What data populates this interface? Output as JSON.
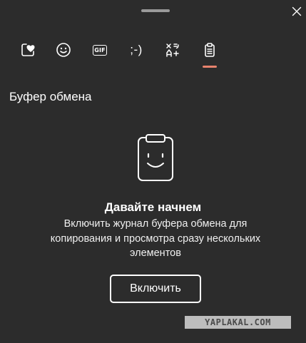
{
  "header": {
    "close_icon": "close-icon"
  },
  "tabs": [
    {
      "id": "favorites",
      "icon": "heart-box-icon"
    },
    {
      "id": "emoji",
      "icon": "smiley-icon"
    },
    {
      "id": "gif",
      "icon": "gif-icon",
      "label": "GIF"
    },
    {
      "id": "kaomoji",
      "icon": "kaomoji-icon",
      "label": ";-)"
    },
    {
      "id": "symbols",
      "icon": "symbols-icon"
    },
    {
      "id": "clipboard",
      "icon": "clipboard-icon",
      "selected": true
    }
  ],
  "accent_color": "#e8836d",
  "section": {
    "title": "Буфер обмена"
  },
  "empty_state": {
    "illustration": "clipboard-smiley-icon",
    "heading": "Давайте начнем",
    "description": "Включить журнал буфера обмена для копирования и просмотра сразу нескольких элементов",
    "button_label": "Включить"
  },
  "watermark": {
    "text": "YAPLAKAL.COM"
  }
}
